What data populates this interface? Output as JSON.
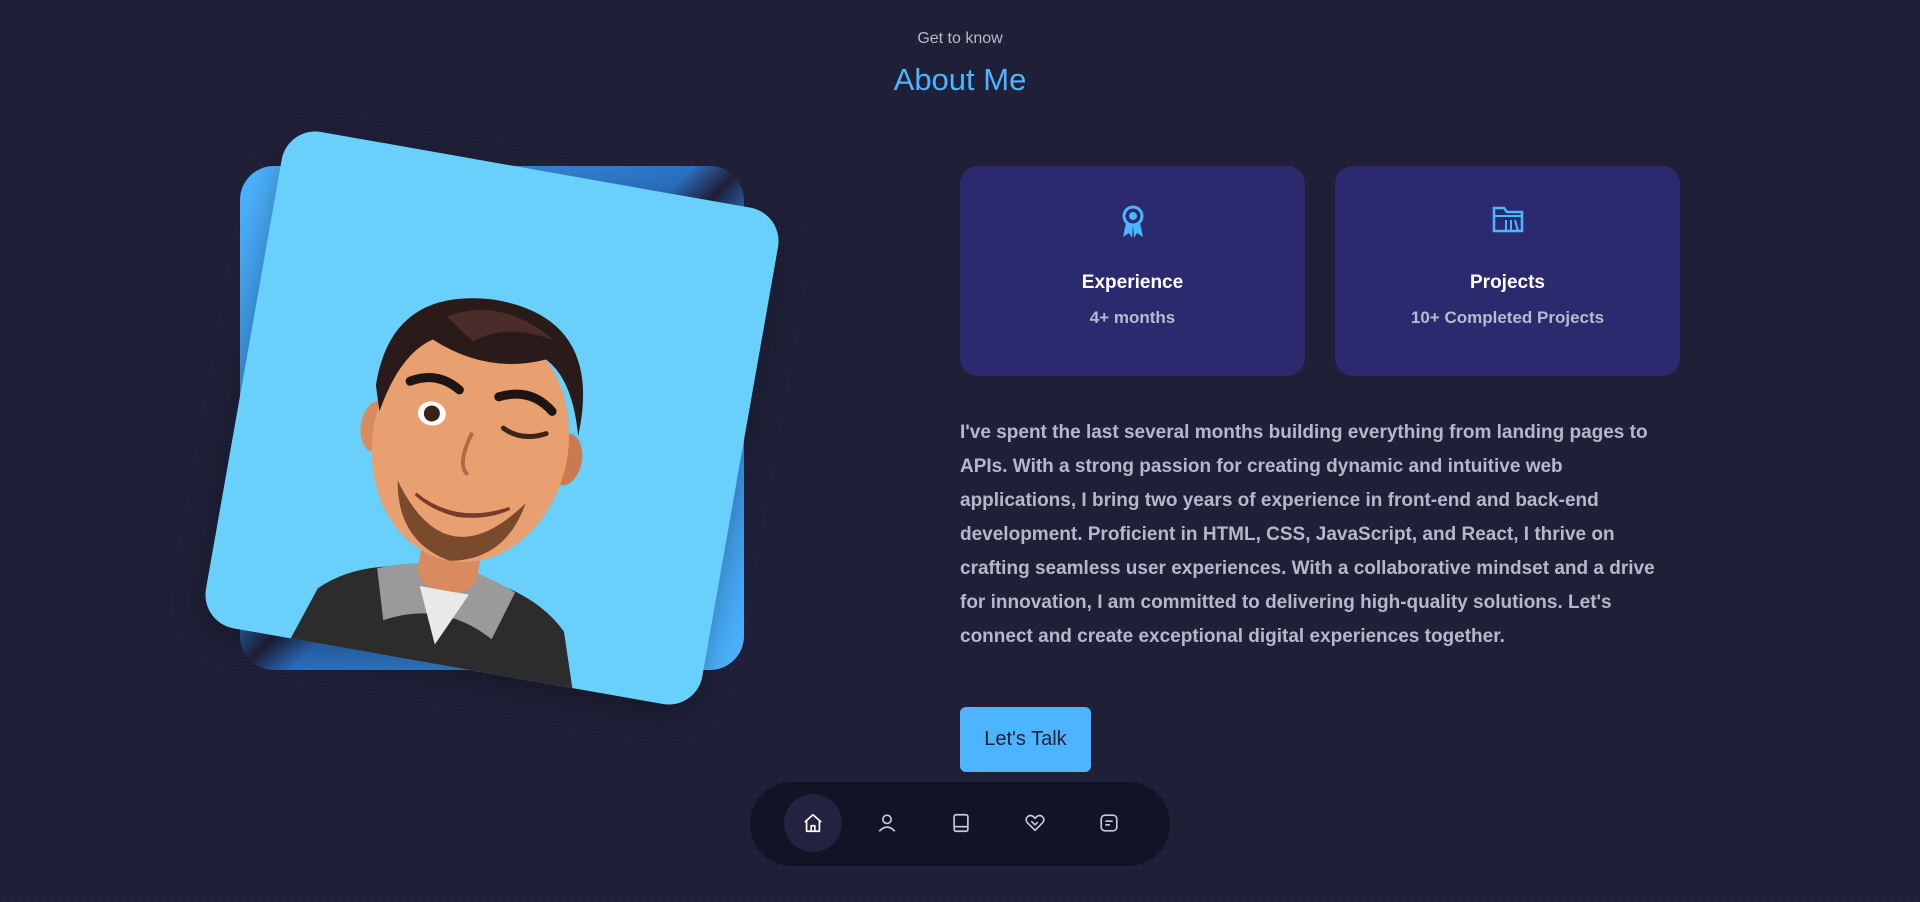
{
  "header": {
    "subtitle": "Get to know",
    "title": "About Me"
  },
  "cards": [
    {
      "icon": "award-icon",
      "title": "Experience",
      "text": "4+ months"
    },
    {
      "icon": "folder-icon",
      "title": "Projects",
      "text": "10+ Completed Projects"
    }
  ],
  "bio": "I've spent the last several months building everything from landing pages to APIs. With a strong passion for creating dynamic and intuitive web applications, I bring two years of experience in front-end and back-end development. Proficient in HTML, CSS, JavaScript, and React, I thrive on crafting seamless user experiences. With a collaborative mindset and a drive for innovation, I am committed to delivering high-quality solutions. Let's connect and create exceptional digital experiences together.",
  "cta": {
    "label": "Let's Talk"
  },
  "nav": [
    {
      "icon": "home-icon",
      "active": true
    },
    {
      "icon": "user-icon",
      "active": false
    },
    {
      "icon": "book-icon",
      "active": false
    },
    {
      "icon": "heart-handshake-icon",
      "active": false
    },
    {
      "icon": "message-icon",
      "active": false
    }
  ],
  "colors": {
    "background": "#1f1f38",
    "accent": "#4db5ff",
    "card": "#2c2a6e",
    "avatar_bg": "#69cffb"
  }
}
